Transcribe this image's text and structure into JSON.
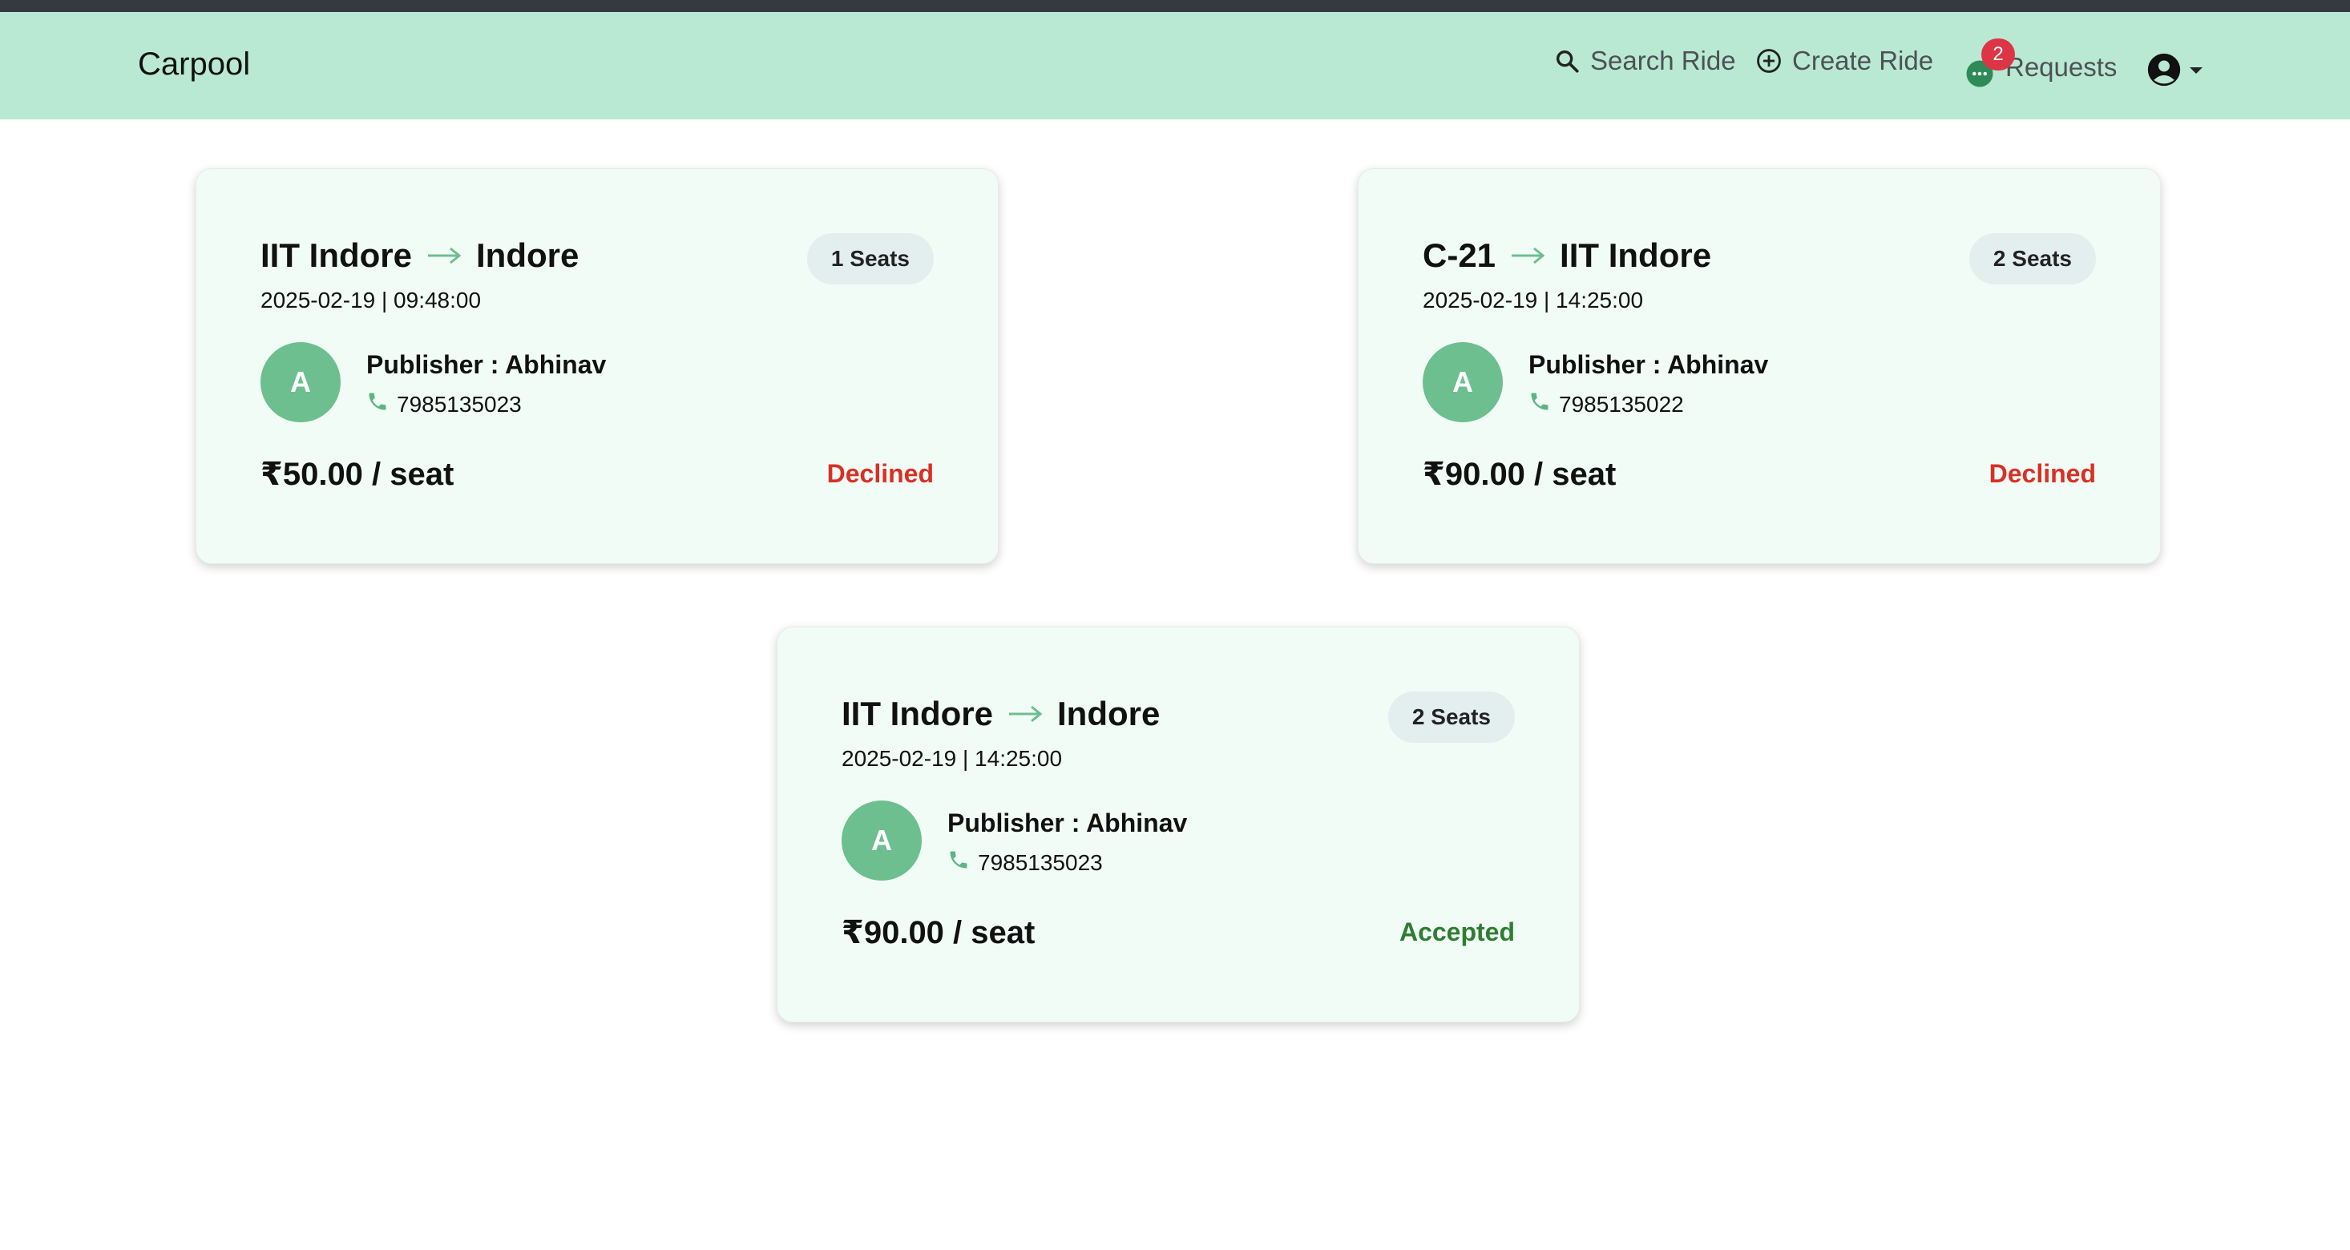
{
  "navbar": {
    "brand": "Carpool",
    "search_label": "Search Ride",
    "create_label": "Create Ride",
    "requests_label": "Requests",
    "requests_badge": "2"
  },
  "colors": {
    "navbar_bg": "#b9e9d3",
    "card_bg": "#f2fcf6",
    "avatar_bg": "#6dbf8f",
    "declined": "#d93025",
    "accepted": "#2e7d32",
    "badge": "#dc3545"
  },
  "rides": [
    {
      "from": "IIT Indore",
      "to": "Indore",
      "datetime": "2025-02-19 | 09:48:00",
      "seats": "1 Seats",
      "avatar_letter": "A",
      "publisher": "Publisher : Abhinav",
      "phone": "7985135023",
      "price": "₹50.00 / seat",
      "status": "Declined"
    },
    {
      "from": "C-21",
      "to": "IIT Indore",
      "datetime": "2025-02-19 | 14:25:00",
      "seats": "2 Seats",
      "avatar_letter": "A",
      "publisher": "Publisher : Abhinav",
      "phone": "7985135022",
      "price": "₹90.00 / seat",
      "status": "Declined"
    },
    {
      "from": "IIT Indore",
      "to": "Indore",
      "datetime": "2025-02-19 | 14:25:00",
      "seats": "2 Seats",
      "avatar_letter": "A",
      "publisher": "Publisher : Abhinav",
      "phone": "7985135023",
      "price": "₹90.00 / seat",
      "status": "Accepted"
    }
  ],
  "icons": {
    "search": "search-icon",
    "create": "plus-circle-icon",
    "requests": "chat-dots-icon",
    "profile": "user-circle-icon",
    "arrow": "arrow-right-icon",
    "phone": "phone-icon"
  }
}
